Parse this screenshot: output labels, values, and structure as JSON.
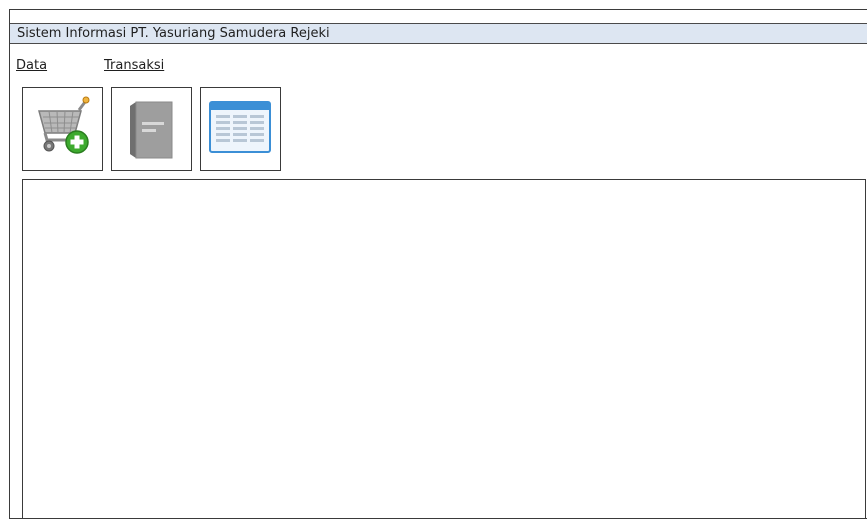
{
  "window": {
    "title": "Sistem Informasi PT. Yasuriang Samudera Rejeki"
  },
  "menu": {
    "items": [
      {
        "label": "Data"
      },
      {
        "label": "Transaksi"
      }
    ]
  },
  "toolbar": {
    "buttons": [
      {
        "icon": "cart-add-icon"
      },
      {
        "icon": "book-icon"
      },
      {
        "icon": "table-icon"
      }
    ]
  },
  "colors": {
    "title_bar": "#dde6f2",
    "border": "#3a3a3a",
    "accent_green": "#3daa2e",
    "accent_blue": "#3b8fd6"
  }
}
